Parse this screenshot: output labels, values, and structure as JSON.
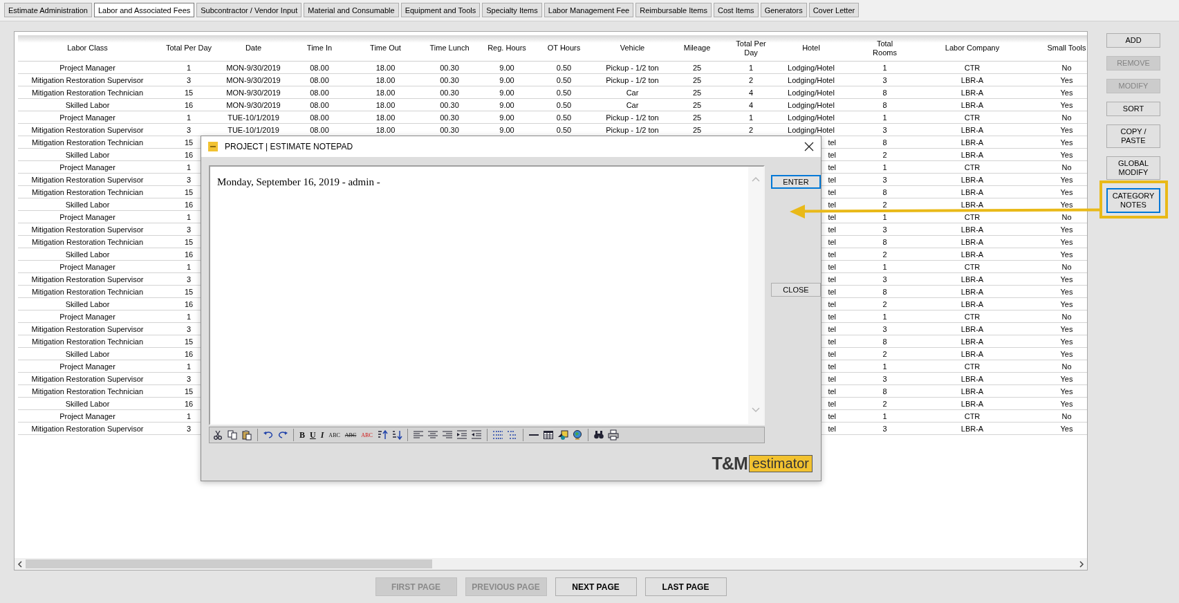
{
  "tabs": [
    {
      "label": "Estimate Administration",
      "selected": false
    },
    {
      "label": "Labor and Associated Fees",
      "selected": true
    },
    {
      "label": "Subcontractor / Vendor Input",
      "selected": false
    },
    {
      "label": "Material and Consumable",
      "selected": false
    },
    {
      "label": "Equipment and Tools",
      "selected": false
    },
    {
      "label": "Specialty Items",
      "selected": false
    },
    {
      "label": "Labor Management Fee",
      "selected": false
    },
    {
      "label": "Reimbursable Items",
      "selected": false
    },
    {
      "label": "Cost Items",
      "selected": false
    },
    {
      "label": "Generators",
      "selected": false
    },
    {
      "label": "Cover Letter",
      "selected": false
    }
  ],
  "table": {
    "columns": [
      "Labor Class",
      "Total Per Day",
      "Date",
      "Time In",
      "Time Out",
      "Time Lunch",
      "Reg. Hours",
      "OT Hours",
      "Vehicle",
      "Mileage",
      "Total Per\nDay",
      "Hotel",
      "Total\nRooms",
      "Labor Company",
      "Small Tools"
    ],
    "rows": [
      {
        "cells": [
          "Project Manager",
          "1",
          "MON-9/30/2019",
          "08.00",
          "18.00",
          "00.30",
          "9.00",
          "0.50",
          "Pickup - 1/2 ton",
          "25",
          "1",
          "Lodging/Hotel",
          "1",
          "CTR",
          "No"
        ]
      },
      {
        "cells": [
          "Mitigation Restoration Supervisor",
          "3",
          "MON-9/30/2019",
          "08.00",
          "18.00",
          "00.30",
          "9.00",
          "0.50",
          "Pickup - 1/2 ton",
          "25",
          "2",
          "Lodging/Hotel",
          "3",
          "LBR-A",
          "Yes"
        ]
      },
      {
        "cells": [
          "Mitigation Restoration Technician",
          "15",
          "MON-9/30/2019",
          "08.00",
          "18.00",
          "00.30",
          "9.00",
          "0.50",
          "Car",
          "25",
          "4",
          "Lodging/Hotel",
          "8",
          "LBR-A",
          "Yes"
        ]
      },
      {
        "cells": [
          "Skilled Labor",
          "16",
          "MON-9/30/2019",
          "08.00",
          "18.00",
          "00.30",
          "9.00",
          "0.50",
          "Car",
          "25",
          "4",
          "Lodging/Hotel",
          "8",
          "LBR-A",
          "Yes"
        ]
      },
      {
        "cells": [
          "Project Manager",
          "1",
          "TUE-10/1/2019",
          "08.00",
          "18.00",
          "00.30",
          "9.00",
          "0.50",
          "Pickup - 1/2 ton",
          "25",
          "1",
          "Lodging/Hotel",
          "1",
          "CTR",
          "No"
        ]
      },
      {
        "cells": [
          "Mitigation Restoration Supervisor",
          "3",
          "TUE-10/1/2019",
          "08.00",
          "18.00",
          "00.30",
          "9.00",
          "0.50",
          "Pickup - 1/2 ton",
          "25",
          "2",
          "Lodging/Hotel",
          "3",
          "LBR-A",
          "Yes"
        ]
      },
      {
        "cells": [
          "Mitigation Restoration Technician",
          "15",
          "tel",
          "8",
          "LBR-A",
          "Yes"
        ]
      },
      {
        "cells": [
          "Skilled Labor",
          "16",
          "tel",
          "2",
          "LBR-A",
          "Yes"
        ]
      },
      {
        "cells": [
          "Project Manager",
          "1",
          "tel",
          "1",
          "CTR",
          "No"
        ]
      },
      {
        "cells": [
          "Mitigation Restoration Supervisor",
          "3",
          "tel",
          "3",
          "LBR-A",
          "Yes"
        ]
      },
      {
        "cells": [
          "Mitigation Restoration Technician",
          "15",
          "tel",
          "8",
          "LBR-A",
          "Yes"
        ]
      },
      {
        "cells": [
          "Skilled Labor",
          "16",
          "tel",
          "2",
          "LBR-A",
          "Yes"
        ]
      },
      {
        "cells": [
          "Project Manager",
          "1",
          "tel",
          "1",
          "CTR",
          "No"
        ]
      },
      {
        "cells": [
          "Mitigation Restoration Supervisor",
          "3",
          "tel",
          "3",
          "LBR-A",
          "Yes"
        ]
      },
      {
        "cells": [
          "Mitigation Restoration Technician",
          "15",
          "tel",
          "8",
          "LBR-A",
          "Yes"
        ]
      },
      {
        "cells": [
          "Skilled Labor",
          "16",
          "tel",
          "2",
          "LBR-A",
          "Yes"
        ]
      },
      {
        "cells": [
          "Project Manager",
          "1",
          "tel",
          "1",
          "CTR",
          "No"
        ]
      },
      {
        "cells": [
          "Mitigation Restoration Supervisor",
          "3",
          "tel",
          "3",
          "LBR-A",
          "Yes"
        ]
      },
      {
        "cells": [
          "Mitigation Restoration Technician",
          "15",
          "tel",
          "8",
          "LBR-A",
          "Yes"
        ]
      },
      {
        "cells": [
          "Skilled Labor",
          "16",
          "tel",
          "2",
          "LBR-A",
          "Yes"
        ]
      },
      {
        "cells": [
          "Project Manager",
          "1",
          "tel",
          "1",
          "CTR",
          "No"
        ]
      },
      {
        "cells": [
          "Mitigation Restoration Supervisor",
          "3",
          "tel",
          "3",
          "LBR-A",
          "Yes"
        ]
      },
      {
        "cells": [
          "Mitigation Restoration Technician",
          "15",
          "tel",
          "8",
          "LBR-A",
          "Yes"
        ]
      },
      {
        "cells": [
          "Skilled Labor",
          "16",
          "tel",
          "2",
          "LBR-A",
          "Yes"
        ]
      },
      {
        "cells": [
          "Project Manager",
          "1",
          "tel",
          "1",
          "CTR",
          "No"
        ]
      },
      {
        "cells": [
          "Mitigation Restoration Supervisor",
          "3",
          "tel",
          "3",
          "LBR-A",
          "Yes"
        ]
      },
      {
        "cells": [
          "Mitigation Restoration Technician",
          "15",
          "tel",
          "8",
          "LBR-A",
          "Yes"
        ]
      },
      {
        "cells": [
          "Skilled Labor",
          "16",
          "tel",
          "2",
          "LBR-A",
          "Yes"
        ]
      },
      {
        "cells": [
          "Project Manager",
          "1",
          "tel",
          "1",
          "CTR",
          "No"
        ]
      },
      {
        "cells": [
          "Mitigation Restoration Supervisor",
          "3",
          "tel",
          "3",
          "LBR-A",
          "Yes"
        ]
      }
    ]
  },
  "side_buttons": [
    {
      "label": "ADD",
      "disabled": false,
      "focused": false
    },
    {
      "label": "REMOVE",
      "disabled": true,
      "focused": false
    },
    {
      "label": "MODIFY",
      "disabled": true,
      "focused": false
    },
    {
      "label": "SORT",
      "disabled": false,
      "focused": false
    },
    {
      "label": "COPY /\nPASTE",
      "disabled": false,
      "focused": false
    },
    {
      "label": "GLOBAL\nMODIFY",
      "disabled": false,
      "focused": false
    },
    {
      "label": "CATEGORY\nNOTES",
      "disabled": false,
      "focused": true,
      "highlighted": true
    }
  ],
  "pager": [
    {
      "label": "FIRST PAGE",
      "disabled": true
    },
    {
      "label": "PREVIOUS PAGE",
      "disabled": true
    },
    {
      "label": "NEXT PAGE",
      "disabled": false
    },
    {
      "label": "LAST PAGE",
      "disabled": false
    }
  ],
  "dialog": {
    "title": "PROJECT | ESTIMATE NOTEPAD",
    "editor_text": "Monday, September 16, 2019 - admin -",
    "toolbar_glyphs": [
      {
        "text": "B",
        "kind": "bold"
      },
      {
        "text": "U",
        "kind": "underline"
      },
      {
        "text": "I",
        "kind": "italic"
      },
      {
        "text": "ABC",
        "kind": "smallcaps"
      },
      {
        "text": "ABC",
        "kind": "spell"
      },
      {
        "text": "ABC",
        "kind": "color"
      }
    ],
    "buttons": [
      {
        "label": "ENTER",
        "focused": true
      },
      {
        "label": "CLOSE",
        "focused": false
      }
    ],
    "logo": {
      "mark": "T&M",
      "word": "estimator"
    }
  }
}
